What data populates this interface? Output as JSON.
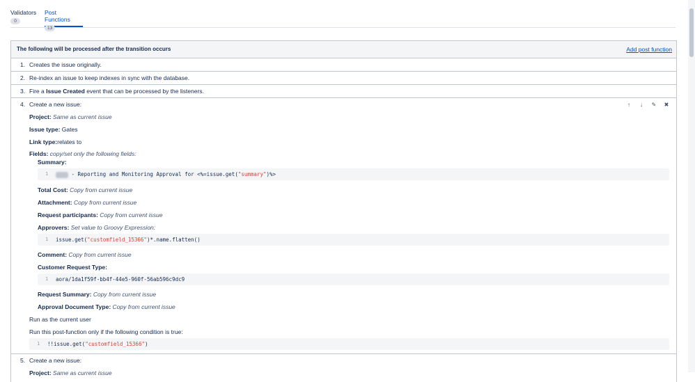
{
  "tabs": [
    {
      "label": "Validators",
      "count": "0"
    },
    {
      "label": "Post Functions",
      "count": "13"
    }
  ],
  "panel": {
    "title": "The following will be processed after the transition occurs",
    "add_link": "Add post function"
  },
  "steps": {
    "s1": {
      "num": "1.",
      "text": "Creates the issue originally."
    },
    "s2": {
      "num": "2.",
      "text": "Re-index an issue to keep indexes in sync with the database."
    },
    "s3": {
      "num": "3.",
      "pre": "Fire a ",
      "bold": "Issue Created",
      "post": " event that can be processed by the listeners."
    },
    "s4": {
      "num": "4.",
      "text": "Create a new issue:",
      "project_label": "Project:",
      "project_value": "Same as current issue",
      "issuetype_label": "Issue type:",
      "issuetype_value": "Gates",
      "linktype_label": "Link type:",
      "linktype_value": "relates to",
      "fields_label": "Fields:",
      "fields_value": "copy/set only the following fields:",
      "summary_label": "Summary:",
      "summary_code_ln": "1",
      "summary_code_a": " - Reporting and Monitoring Approval for <%=issue.get(",
      "summary_code_str": "\"summary\"",
      "summary_code_b": ")%>",
      "totalcost_label": "Total Cost:",
      "totalcost_value": "Copy from current issue",
      "attachment_label": "Attachment:",
      "attachment_value": "Copy from current issue",
      "participants_label": "Request participants:",
      "participants_value": "Copy from current issue",
      "approvers_label": "Approvers:",
      "approvers_value": "Set value to Groovy Expression:",
      "approvers_code_ln": "1",
      "approvers_code_a": "issue.get(",
      "approvers_code_str": "\"customfield_15366\"",
      "approvers_code_b": ")*.name.flatten()",
      "comment_label": "Comment:",
      "comment_value": "Copy from current issue",
      "crt_label": "Customer Request Type:",
      "crt_code_ln": "1",
      "crt_code": "aora/1da1f59f-bb4f-44e5-960f-56ab596c9dc9",
      "reqsummary_label": "Request Summary:",
      "reqsummary_value": "Copy from current issue",
      "approvaldoc_label": "Approval Document Type:",
      "approvaldoc_value": "Copy from current issue",
      "run_as": "Run as the current user",
      "condition_text": "Run this post-function only if the following condition is true:",
      "cond_code_ln": "1",
      "cond_code_a": "!!issue.get(",
      "cond_code_str": "\"customfield_15366\"",
      "cond_code_b": ")"
    },
    "s5": {
      "num": "5.",
      "text": "Create a new issue:",
      "project_label": "Project:",
      "project_value": "Same as current issue"
    }
  },
  "icons": {
    "up": "arrow-up-icon",
    "down": "arrow-down-icon",
    "edit": "pencil-icon",
    "delete": "close-circle-icon"
  }
}
